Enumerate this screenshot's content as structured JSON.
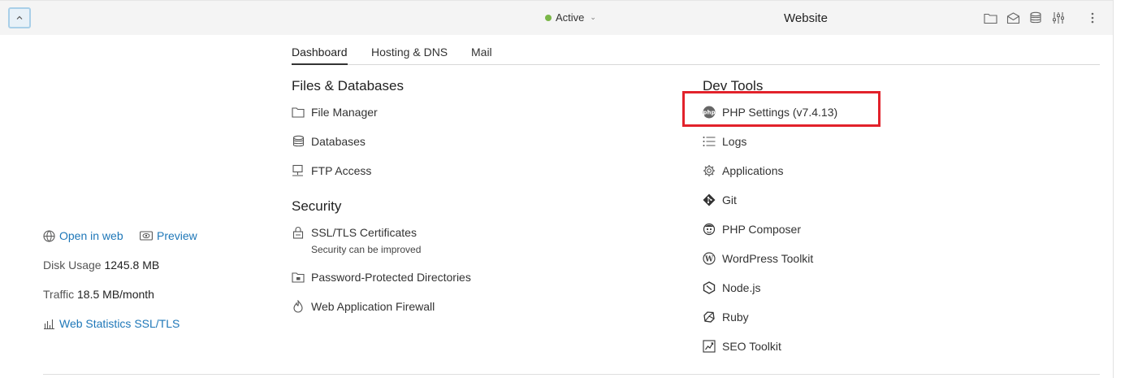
{
  "topbar": {
    "status": "Active",
    "site_name": "Website",
    "icons": [
      "folder-icon",
      "mail-icon",
      "database-icon",
      "sliders-icon",
      "more-icon"
    ]
  },
  "tabs": [
    "Dashboard",
    "Hosting & DNS",
    "Mail"
  ],
  "left": {
    "open_in_web": "Open in web",
    "preview": "Preview",
    "disk_usage_label": "Disk Usage",
    "disk_usage_value": "1245.8 MB",
    "traffic_label": "Traffic",
    "traffic_value": "18.5 MB/month",
    "web_stats": "Web Statistics SSL/TLS"
  },
  "files_databases": {
    "title": "Files & Databases",
    "items": [
      "File Manager",
      "Databases",
      "FTP Access"
    ]
  },
  "security": {
    "title": "Security",
    "items": [
      "SSL/TLS Certificates",
      "Password-Protected Directories",
      "Web Application Firewall"
    ],
    "ssl_note": "Security can be improved"
  },
  "dev_tools": {
    "title": "Dev Tools",
    "items": [
      "PHP Settings (v7.4.13)",
      "Logs",
      "Applications",
      "Git",
      "PHP Composer",
      "WordPress Toolkit",
      "Node.js",
      "Ruby",
      "SEO Toolkit"
    ]
  },
  "colors": {
    "accent_link": "#1e77b8",
    "status_active": "#7ab648",
    "highlight": "#e2222b"
  }
}
